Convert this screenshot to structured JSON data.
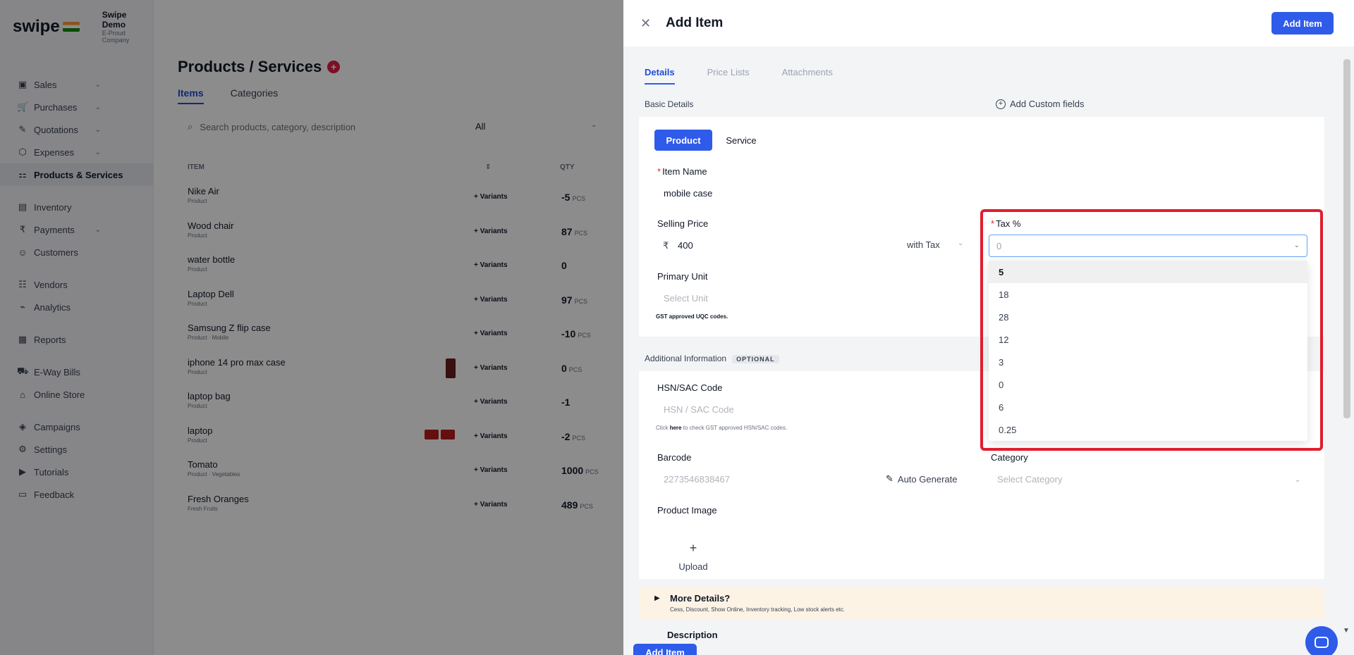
{
  "app": {
    "brand": "swipe",
    "org_name": "Swipe Demo",
    "org_sub": "E-Proud Company",
    "nav": [
      {
        "label": "Sales",
        "icon": "sales-icon",
        "glyph": "▣",
        "chev": true
      },
      {
        "label": "Purchases",
        "icon": "cart-icon",
        "glyph": "🛒",
        "chev": true
      },
      {
        "label": "Quotations",
        "icon": "pen-icon",
        "glyph": "✎",
        "chev": true
      },
      {
        "label": "Expenses",
        "icon": "tag-icon",
        "glyph": "⬡",
        "chev": true
      },
      {
        "label": "Products & Services",
        "icon": "products-icon",
        "glyph": "⚏",
        "active": true
      },
      {
        "label": "Inventory",
        "icon": "inventory-icon",
        "glyph": "▤"
      },
      {
        "label": "Payments",
        "icon": "rupee-icon",
        "glyph": "₹",
        "chev": true
      },
      {
        "label": "Customers",
        "icon": "user-icon",
        "glyph": "☺"
      },
      {
        "label": "Vendors",
        "icon": "vendor-icon",
        "glyph": "☷"
      },
      {
        "label": "Analytics",
        "icon": "chart-icon",
        "glyph": "⌁"
      },
      {
        "label": "Reports",
        "icon": "report-icon",
        "glyph": "▦"
      },
      {
        "label": "E-Way Bills",
        "icon": "truck-icon",
        "glyph": "⛟"
      },
      {
        "label": "Online Store",
        "icon": "store-icon",
        "glyph": "⌂"
      },
      {
        "label": "Campaigns",
        "icon": "megaphone-icon",
        "glyph": "◈"
      },
      {
        "label": "Settings",
        "icon": "gear-icon",
        "glyph": "⚙"
      },
      {
        "label": "Tutorials",
        "icon": "youtube-icon",
        "glyph": "▶"
      },
      {
        "label": "Feedback",
        "icon": "message-icon",
        "glyph": "▭"
      }
    ],
    "page_title": "Products / Services",
    "tabs": [
      "Items",
      "Categories"
    ],
    "search_placeholder": "Search products, category, description",
    "filter_value": "All",
    "table_headers": {
      "item": "ITEM",
      "qty": "QTY"
    },
    "variants_label": "+ Variants",
    "products": [
      {
        "name": "Nike Air",
        "sub": "Product",
        "qty": "-5",
        "unit": "PCS"
      },
      {
        "name": "Wood chair",
        "sub": "Product",
        "qty": "87",
        "unit": "PCS"
      },
      {
        "name": "water bottle",
        "sub": "Product",
        "qty": "0",
        "unit": ""
      },
      {
        "name": "Laptop Dell",
        "sub": "Product",
        "qty": "97",
        "unit": "PCS"
      },
      {
        "name": "Samsung Z flip case",
        "sub": "Product · Mobile",
        "qty": "-10",
        "unit": "PCS"
      },
      {
        "name": "iphone 14 pro max case",
        "sub": "Product",
        "qty": "0",
        "unit": "PCS"
      },
      {
        "name": "laptop bag",
        "sub": "Product",
        "qty": "-1",
        "unit": ""
      },
      {
        "name": "laptop",
        "sub": "Product",
        "qty": "-2",
        "unit": "PCS"
      },
      {
        "name": "Tomato",
        "sub": "Product · Vegetables",
        "qty": "1000",
        "unit": "PCS"
      },
      {
        "name": "Fresh Oranges",
        "sub": "Fresh Fruits",
        "qty": "489",
        "unit": "PCS"
      }
    ]
  },
  "drawer": {
    "title": "Add Item",
    "header_button": "Add Item",
    "footer_button": "Add Item",
    "tabs": [
      "Details",
      "Price Lists",
      "Attachments"
    ],
    "basic_details_label": "Basic Details",
    "add_custom_fields": "Add Custom fields",
    "type_product": "Product",
    "type_service": "Service",
    "item_name_label": "Item Name",
    "item_name_value": "mobile case",
    "selling_price_label": "Selling Price",
    "currency_symbol": "₹",
    "selling_price_value": "400",
    "with_tax": "with Tax",
    "tax_label": "Tax %",
    "tax_input_value": "0",
    "tax_options": [
      "5",
      "18",
      "28",
      "12",
      "3",
      "0",
      "6",
      "0.25"
    ],
    "tax_selected": "5",
    "primary_unit_label": "Primary Unit",
    "primary_unit_placeholder": "Select Unit",
    "unit_help": "GST approved UQC codes.",
    "additional_info_label": "Additional Information",
    "optional_tag": "OPTIONAL",
    "hsn_label": "HSN/SAC Code",
    "hsn_placeholder": "HSN / SAC Code",
    "hsn_help_prefix": "Click",
    "hsn_help_link": "here",
    "hsn_help_suffix": "to check GST approved HSN/SAC codes.",
    "barcode_label": "Barcode",
    "barcode_placeholder": "2273546838467",
    "auto_generate": "Auto Generate",
    "category_label": "Category",
    "category_placeholder": "Select Category",
    "product_image_label": "Product Image",
    "upload_label": "Upload",
    "more_details_title": "More Details?",
    "more_details_sub": "Cess, Discount, Show Online, Inventory tracking, Low stock alerts etc.",
    "description_label": "Description"
  }
}
